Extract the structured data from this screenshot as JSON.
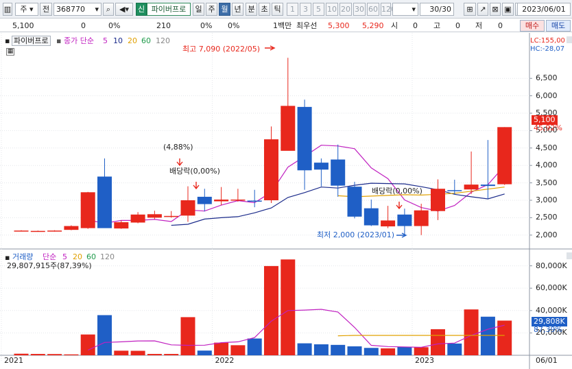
{
  "toolbar": {
    "type": "주",
    "prefix": "전",
    "code": "368770",
    "badge": "신",
    "name": "파이버프로",
    "periods": [
      "일",
      "주",
      "월",
      "년"
    ],
    "units": [
      "분",
      "초",
      "틱"
    ],
    "nums": [
      "1",
      "3",
      "5",
      "10",
      "20",
      "30",
      "60",
      "120"
    ],
    "count": "30/30",
    "date": "2023/06/01",
    "active_period": "월"
  },
  "quote": {
    "price": "5,100",
    "change": "0",
    "change_pct": "0%",
    "volume": "210",
    "vol_pct": "0%",
    "pct3": "0%",
    "unit": "1백만",
    "best_label": "최우선",
    "ask": "5,300",
    "bid": "5,290",
    "open_label": "시",
    "open": "0",
    "high_label": "고",
    "high": "0",
    "low_label": "저",
    "low": "0",
    "buy": "매수",
    "sell": "매도"
  },
  "legend": {
    "name": "파이버프로",
    "ma_label": "종가 단순",
    "ma_periods": [
      "5",
      "10",
      "20",
      "60",
      "120"
    ],
    "lc": "LC:155,00",
    "hc": "HC:-28,07",
    "vol_label": "거래량",
    "vol_ma_label": "단순",
    "vol_periods": [
      "5",
      "20",
      "60",
      "120"
    ],
    "vol_value": "29,807,915주(87,39%)"
  },
  "annotations": {
    "high": "최고 7,090 (2022/05)",
    "low": "최저 2,000 (2023/01)",
    "pct": "(4,88%)",
    "div1": "배당락(0,00%)",
    "div2": "배당락(0,00%)"
  },
  "tags": {
    "price": "5,100",
    "pct": "45,92%",
    "vol": "29,808K",
    "vol_pct": "87,39%"
  },
  "colors": {
    "up": "#e8271c",
    "down": "#1f5fc6",
    "ma5": "#c020c0",
    "ma10": "#1a2a8a",
    "ma20": "#e0a000",
    "ma60": "#1e9a4a",
    "ma120": "#888888"
  },
  "chart_data": {
    "type": "candlestick",
    "x": [
      "2021/01",
      "2021/02",
      "2021/03",
      "2021/04",
      "2021/05",
      "2021/06",
      "2021/07",
      "2021/08",
      "2021/09",
      "2021/10",
      "2021/11",
      "2021/12",
      "2022/01",
      "2022/02",
      "2022/03",
      "2022/04",
      "2022/05",
      "2022/06",
      "2022/07",
      "2022/08",
      "2022/09",
      "2022/10",
      "2022/11",
      "2022/12",
      "2023/01",
      "2023/02",
      "2023/03",
      "2023/04",
      "2023/05",
      "2023/06"
    ],
    "ohlc": [
      [
        2120,
        2140,
        2110,
        2130
      ],
      [
        2110,
        2130,
        2100,
        2120
      ],
      [
        2110,
        2140,
        2100,
        2130
      ],
      [
        2150,
        2280,
        2140,
        2260
      ],
      [
        2200,
        3240,
        2180,
        3230
      ],
      [
        3680,
        4200,
        2260,
        2200
      ],
      [
        2190,
        2420,
        2180,
        2370
      ],
      [
        2360,
        2660,
        2340,
        2590
      ],
      [
        2500,
        2700,
        2460,
        2600
      ],
      [
        2550,
        2690,
        2500,
        2550
      ],
      [
        2560,
        3400,
        2380,
        3000
      ],
      [
        3100,
        3330,
        2680,
        2890
      ],
      [
        2970,
        3380,
        2860,
        3020
      ],
      [
        3000,
        3330,
        2960,
        3020
      ],
      [
        2990,
        3300,
        2800,
        2960
      ],
      [
        3000,
        5120,
        2920,
        4750
      ],
      [
        4420,
        7090,
        4550,
        5710
      ],
      [
        5680,
        5890,
        3300,
        3860
      ],
      [
        4080,
        4200,
        3400,
        3880
      ],
      [
        4170,
        4600,
        3100,
        3420
      ],
      [
        3390,
        3530,
        2480,
        2530
      ],
      [
        2770,
        3020,
        2260,
        2280
      ],
      [
        2250,
        2840,
        2200,
        2420
      ],
      [
        2590,
        2760,
        2000,
        2260
      ],
      [
        2260,
        2900,
        2000,
        2710
      ],
      [
        2690,
        3600,
        2430,
        3330
      ],
      [
        3290,
        3590,
        3160,
        3280
      ],
      [
        3310,
        4400,
        3180,
        3450
      ],
      [
        3450,
        4730,
        3040,
        3410
      ],
      [
        3460,
        5100,
        3440,
        5100
      ]
    ],
    "volume_k": [
      1400,
      1200,
      1100,
      800,
      18600,
      35900,
      4100,
      4000,
      1200,
      1200,
      34100,
      4200,
      11300,
      9000,
      15000,
      79800,
      85700,
      10700,
      9800,
      9300,
      8000,
      6600,
      6200,
      7500,
      7200,
      23300,
      10500,
      41000,
      34500,
      31000
    ],
    "series": [
      {
        "name": "5",
        "values": [
          null,
          null,
          null,
          null,
          2430,
          2340,
          2420,
          2420,
          2450,
          2390,
          2720,
          2690,
          2860,
          2990,
          2930,
          3230,
          3950,
          4260,
          4580,
          4560,
          4480,
          3930,
          3620,
          3010,
          2790,
          2690,
          2850,
          3230,
          3450,
          3990
        ]
      },
      {
        "name": "10",
        "values": [
          null,
          null,
          null,
          null,
          null,
          null,
          null,
          null,
          null,
          2280,
          2310,
          2460,
          2500,
          2530,
          2640,
          2780,
          3080,
          3220,
          3380,
          3350,
          3430,
          3490,
          3480,
          3470,
          3390,
          3300,
          3170,
          3100,
          3040,
          3180
        ]
      },
      {
        "name": "20",
        "values": [
          null,
          null,
          null,
          null,
          null,
          null,
          null,
          null,
          null,
          null,
          null,
          null,
          null,
          null,
          null,
          null,
          null,
          null,
          null,
          3130,
          3100,
          3120,
          3140,
          3160,
          3150,
          3170,
          3200,
          3260,
          3320,
          3380
        ]
      }
    ],
    "volume_series": [
      {
        "name": "5",
        "values": [
          null,
          null,
          null,
          null,
          4600,
          11500,
          12000,
          12800,
          12900,
          9300,
          8900,
          9000,
          11300,
          12000,
          15800,
          30500,
          40000,
          40400,
          41100,
          38700,
          24900,
          8900,
          7800,
          7500,
          7100,
          10200,
          10900,
          17800,
          23300,
          26900
        ]
      },
      {
        "name": "20",
        "values": [
          null,
          null,
          null,
          null,
          null,
          null,
          null,
          null,
          null,
          null,
          null,
          null,
          null,
          null,
          null,
          null,
          null,
          null,
          null,
          17400,
          17800,
          17800,
          17800,
          17800,
          17800,
          17800,
          17800,
          17800,
          17800,
          17800
        ]
      }
    ],
    "price_ticks": [
      "2,000",
      "2,500",
      "3,000",
      "3,500",
      "4,000",
      "4,500",
      "5,000",
      "5,500",
      "6,000",
      "6,500"
    ],
    "volume_ticks": [
      "20,000K",
      "40,000K",
      "60,000K",
      "80,000K"
    ],
    "x_ticks": [
      "2021",
      "2022",
      "2023",
      "06/01"
    ],
    "ylim": [
      1700,
      7450
    ],
    "vol_ylim": [
      0,
      92000
    ]
  }
}
